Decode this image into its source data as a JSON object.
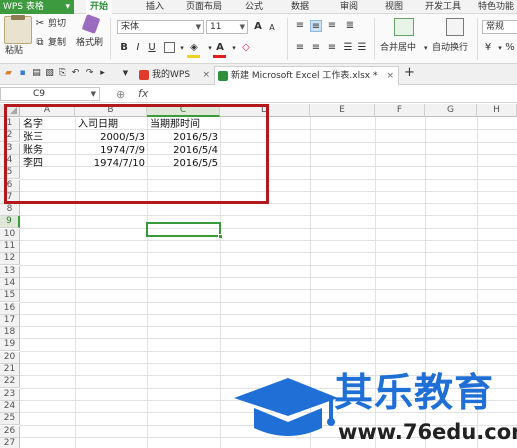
{
  "menubar": {
    "app_button": "WPS 表格",
    "tabs": [
      {
        "label": "开始",
        "active": true
      },
      {
        "label": "插入"
      },
      {
        "label": "页面布局"
      },
      {
        "label": "公式"
      },
      {
        "label": "数据"
      },
      {
        "label": "审阅"
      },
      {
        "label": "视图"
      },
      {
        "label": "开发工具"
      },
      {
        "label": "特色功能"
      }
    ]
  },
  "ribbon": {
    "paste": "粘贴",
    "cut": "剪切",
    "copy": "复制",
    "format_painter": "格式刷",
    "font_name": "宋体",
    "font_size": "11",
    "merge_center": "合并居中",
    "wrap_text": "自动换行",
    "number_format": "常规",
    "percent": "%"
  },
  "tabbar": {
    "tabs": [
      {
        "label": "我的WPS",
        "icon": "wps-logo-icon",
        "active": false
      },
      {
        "label": "新建 Microsoft Excel 工作表.xlsx *",
        "icon": "excel-doc-icon",
        "active": true
      }
    ],
    "close_glyph": "×",
    "add_glyph": "+"
  },
  "formula_bar": {
    "name_box": "C9",
    "fx": "fx",
    "value": ""
  },
  "sheet": {
    "columns": [
      "A",
      "B",
      "C",
      "D",
      "E",
      "F",
      "G",
      "H"
    ],
    "rows": [
      "1",
      "2",
      "3",
      "4",
      "5",
      "6",
      "7",
      "8",
      "9",
      "10",
      "11",
      "12",
      "13",
      "14",
      "15",
      "16",
      "17",
      "18",
      "19",
      "20",
      "21",
      "22",
      "23",
      "24",
      "25",
      "26",
      "27"
    ],
    "cells": {
      "A1": "名字",
      "B1": "入司日期",
      "C1": "当期那时间",
      "A2": "张三",
      "B2": "2000/5/3",
      "C2": "2016/5/3",
      "A3": "账务",
      "B3": "1974/7/9",
      "C3": "2016/5/4",
      "A4": "李四",
      "B4": "1974/7/10",
      "C4": "2016/5/5"
    },
    "selected_cell": "C9"
  },
  "watermark": {
    "title": "其乐教育",
    "url": "www.76edu.com",
    "colors": {
      "blue": "#1f6fd6",
      "dark": "#222222"
    }
  },
  "colors": {
    "wps_green": "#3d9a3f",
    "highlight_red": "#b3191c",
    "selection_green": "#3a9a3a"
  }
}
